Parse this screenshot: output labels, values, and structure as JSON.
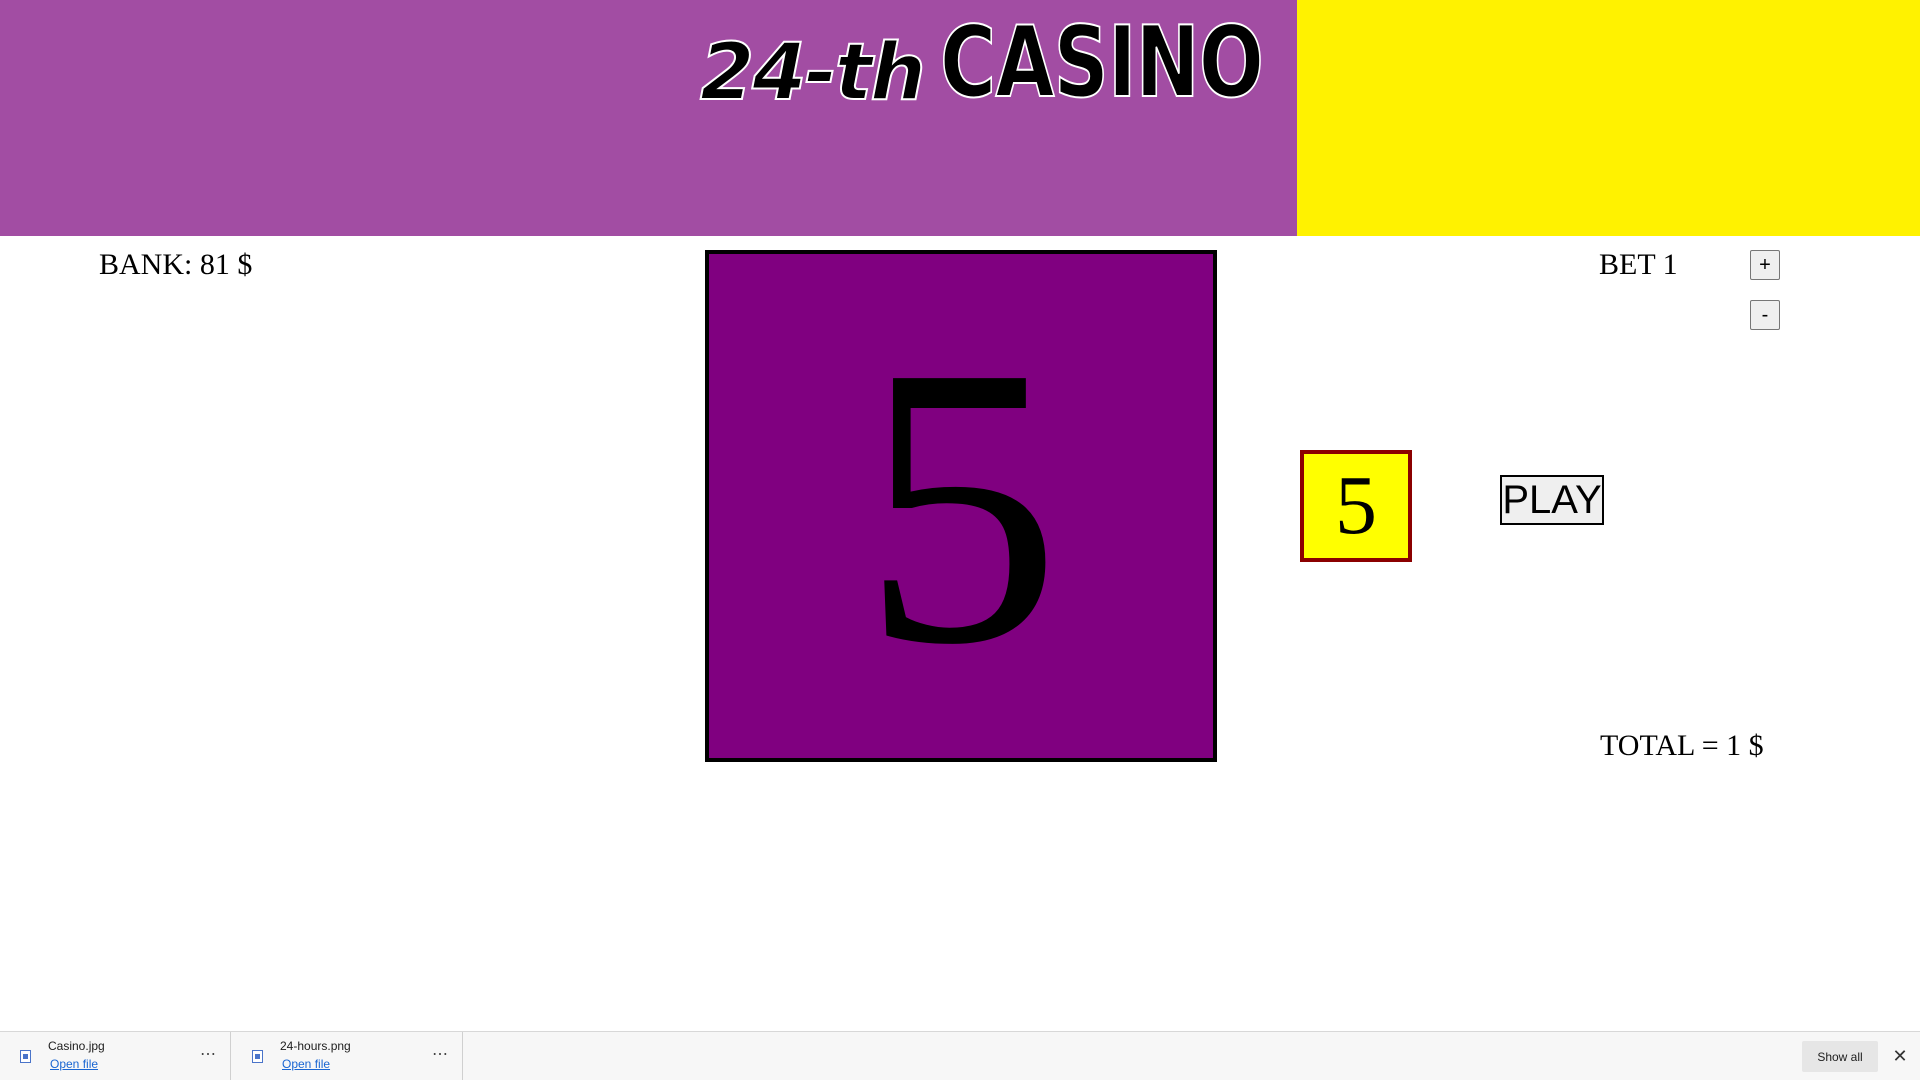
{
  "header": {
    "logo_part1": "24-th",
    "logo_part2": "CASINO"
  },
  "game": {
    "bank_label": "BANK: 81 $",
    "big_number": "5",
    "small_number": "5",
    "play_label": "PLAY",
    "bet_label": "BET 1",
    "plus_label": "+",
    "minus_label": "-",
    "total_label": "TOTAL = 1 $"
  },
  "colors": {
    "header_purple": "#a24da3",
    "header_yellow": "#fff200",
    "display_purple": "#800080",
    "small_display_yellow": "#ffff00",
    "small_display_border": "#8b0000"
  },
  "downloads": {
    "items": [
      {
        "name": "Casino.jpg",
        "open_label": "Open file",
        "icon": "file-icon",
        "more": "⋯"
      },
      {
        "name": "24-hours.png",
        "open_label": "Open file",
        "icon": "file-icon",
        "more": "⋯"
      }
    ],
    "show_all_label": "Show all",
    "close_glyph": "✕"
  }
}
